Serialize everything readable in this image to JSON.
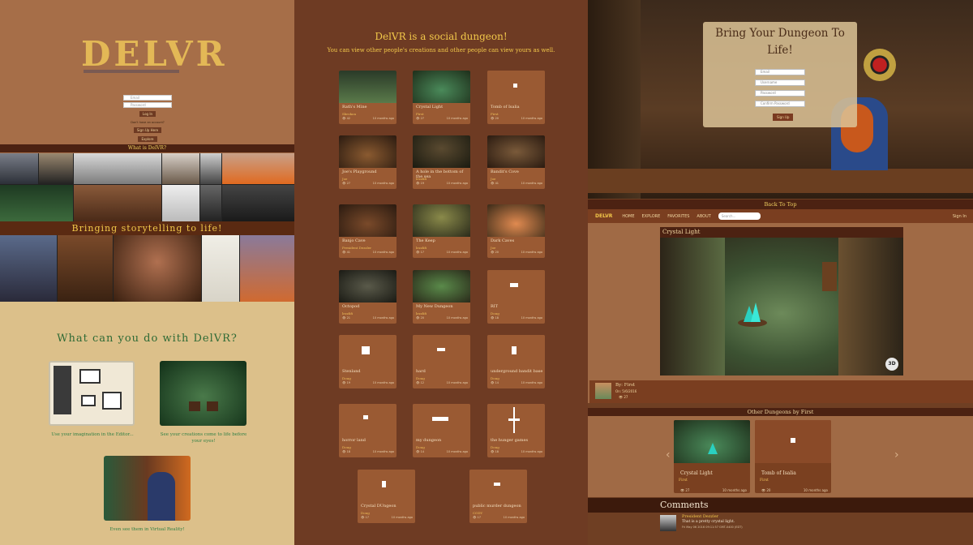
{
  "landing": {
    "logo": "DELVR",
    "login": {
      "email_placeholder": "Email",
      "password_placeholder": "Password",
      "login_label": "Log In",
      "no_account_text": "Don't have an account?",
      "signup_label": "Sign Up Here",
      "explore_label": "Explore"
    },
    "what_is_label": "What is DelVR?",
    "story_banner": "Bringing storytelling to life!",
    "what_can_title": "What can you do with DelVR?",
    "features": [
      {
        "caption": "Use your imagination in the Editor..."
      },
      {
        "caption": "See your creations come to life before your eyes!"
      },
      {
        "caption": "Even see them in Virtual Reality!"
      }
    ]
  },
  "gallery": {
    "title": "DelVR is a social dungeon!",
    "subtitle": "You can view other people's creations and other people can view yours as well.",
    "cards": [
      {
        "title": "Rath's Mine",
        "user": "Sbrokon",
        "views": "42",
        "age": "10 months ago"
      },
      {
        "title": "Crystal Light",
        "user": "First",
        "views": "27",
        "age": "10 months ago"
      },
      {
        "title": "Tomb of Isalia",
        "user": "First",
        "views": "20",
        "age": "10 months ago"
      },
      {
        "title": "Joe's Playground",
        "user": "Joe",
        "views": "27",
        "age": "10 months ago"
      },
      {
        "title": "A hole in the bottom of the sea",
        "user": "lezzlifi",
        "views": "19",
        "age": "10 months ago"
      },
      {
        "title": "Bandit's Cove",
        "user": "Joe",
        "views": "41",
        "age": "10 months ago"
      },
      {
        "title": "Banjo Cave",
        "user": "President Dezzler",
        "views": "41",
        "age": "10 months ago"
      },
      {
        "title": "The Keep",
        "user": "lezzlifi",
        "views": "17",
        "age": "10 months ago"
      },
      {
        "title": "Dark Caves",
        "user": "Joe",
        "views": "20",
        "age": "10 months ago"
      },
      {
        "title": "Octopod",
        "user": "lezzlifi",
        "views": "21",
        "age": "10 months ago"
      },
      {
        "title": "My New Dungeon",
        "user": "lezzlifi",
        "views": "20",
        "age": "10 months ago"
      },
      {
        "title": "RIT",
        "user": "Doug",
        "views": "18",
        "age": "10 months ago"
      },
      {
        "title": "Stenland",
        "user": "Doug",
        "views": "19",
        "age": "10 months ago"
      },
      {
        "title": "hard",
        "user": "Doug",
        "views": "12",
        "age": "10 months ago"
      },
      {
        "title": "underground bandit base",
        "user": "Doug",
        "views": "14",
        "age": "10 months ago"
      },
      {
        "title": "horror land",
        "user": "Doug",
        "views": "18",
        "age": "10 months ago"
      },
      {
        "title": "my dungeon",
        "user": "Doug",
        "views": "14",
        "age": "10 months ago"
      },
      {
        "title": "the hunger games",
        "user": "Doug",
        "views": "18",
        "age": "10 months ago"
      },
      {
        "title": "Crystal DUngeon",
        "user": "Doug",
        "views": "17",
        "age": "10 months ago"
      },
      {
        "title": "public murder dungeon",
        "user": "CODY",
        "views": "17",
        "age": "10 months ago"
      }
    ]
  },
  "detail": {
    "hero_title": "Bring Your Dungeon To Life!",
    "form": {
      "email": "Email",
      "username": "Username",
      "password": "Password",
      "confirm": "Confirm Password",
      "signup": "Sign Up"
    },
    "back_to_top": "Back To Top",
    "nav": {
      "brand": "DELVR",
      "items": [
        "HOME",
        "EXPLORE",
        "FAVORITES",
        "ABOUT"
      ],
      "search_placeholder": "Search...",
      "signin": "Sign In"
    },
    "dungeon_title": "Crystal Light",
    "vr_badge": "3D",
    "by": "By: First",
    "on": "On: 5/6/2016",
    "views": "27",
    "other_header": "Other Dungeons by First",
    "others": [
      {
        "title": "Crystal Light",
        "user": "First",
        "views": "27",
        "age": "10 months ago"
      },
      {
        "title": "Tomb of Isalia",
        "user": "First",
        "views": "20",
        "age": "10 months ago"
      }
    ],
    "comments_title": "Comments",
    "comment": {
      "author": "President Dezzler",
      "text": "That is a pretty crystal light.",
      "meta": "Fri May 06 2016 09:11:57 GMT-0400 (EDT)"
    }
  }
}
